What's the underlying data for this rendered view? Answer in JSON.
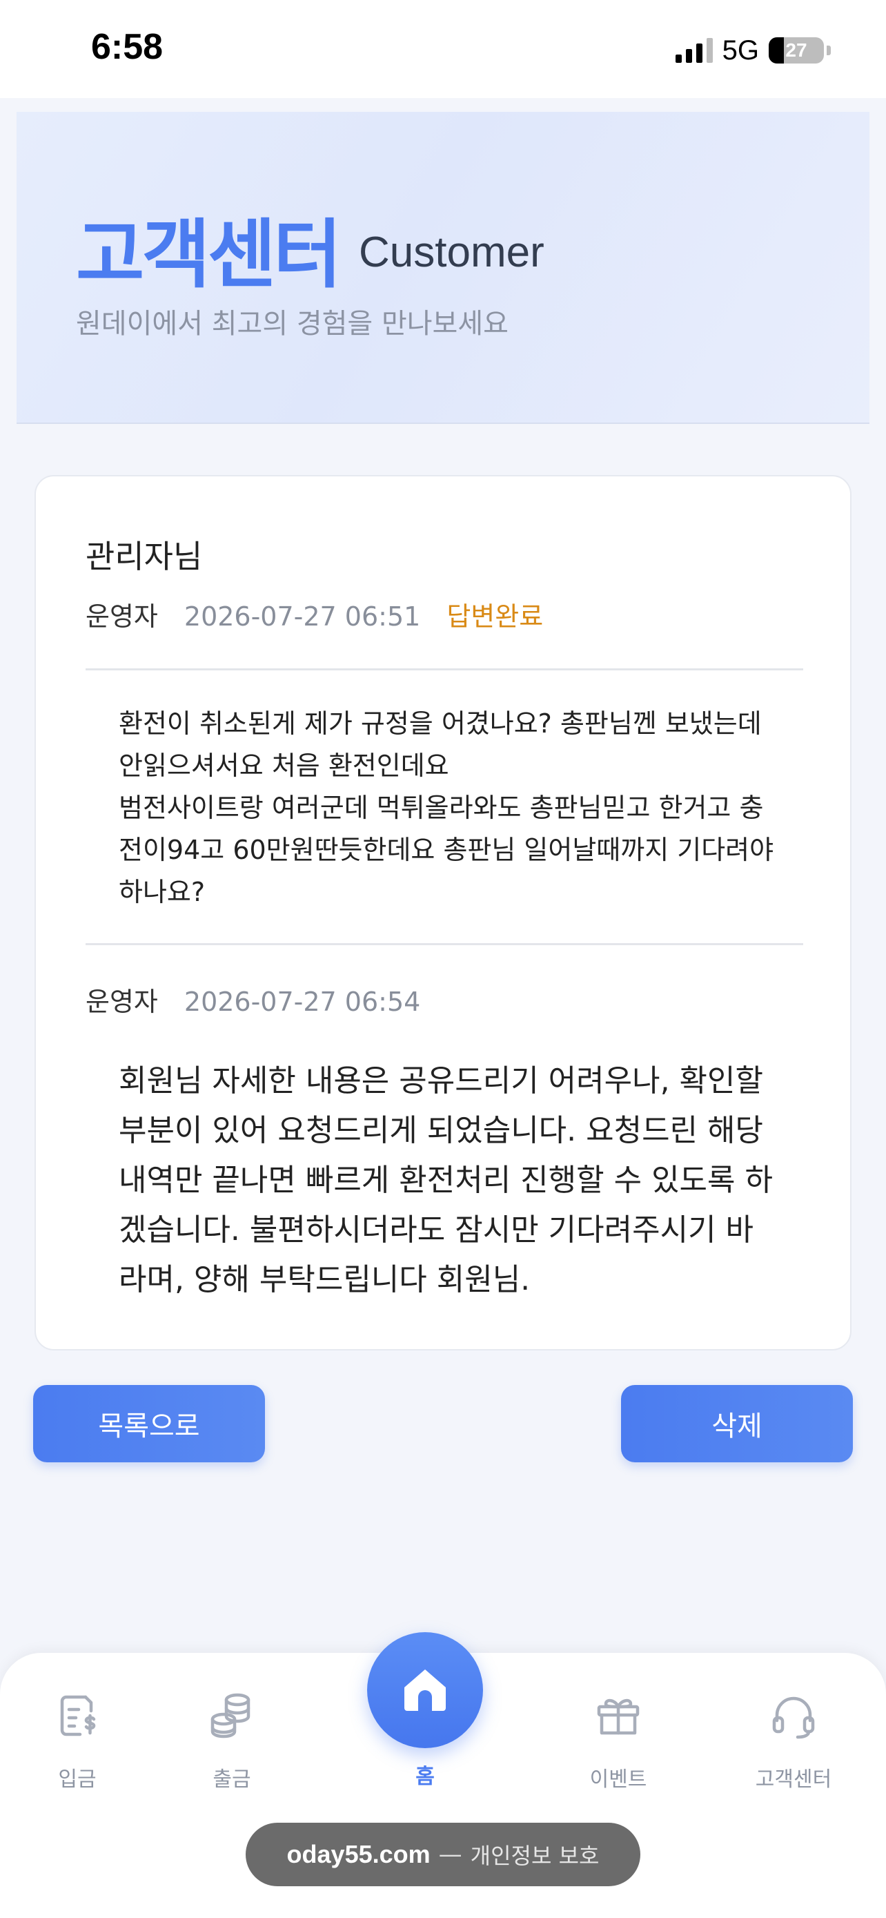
{
  "status_bar": {
    "time": "6:58",
    "network": "5G",
    "battery": "27"
  },
  "hero": {
    "title": "고객센터",
    "subtitle_en": "Customer",
    "description": "원데이에서 최고의 경험을 만나보세요",
    "accent_color": "#4b7cf0"
  },
  "inquiry": {
    "title": "관리자님",
    "author": "운영자",
    "date": "2026-07-27 06:51",
    "status": "답변완료",
    "status_color": "#d98a16",
    "body": "환전이 취소된게 제가 규정을 어겼나요? 총판님껜 보냈는데 안읽으셔서요 처음 환전인데요\n범전사이트랑 여러군데 먹튀올라와도 총판님믿고 한거고 충전이94고 60만원딴듯한데요 총판님 일어날때까지 기다려야하나요?"
  },
  "reply": {
    "author": "운영자",
    "date": "2026-07-27 06:54",
    "body": "회원님 자세한 내용은 공유드리기 어려우나, 확인할 부분이 있어 요청드리게 되었습니다. 요청드린 해당 내역만 끝나면 빠르게 환전처리 진행할 수 있도록 하겠습니다. 불편하시더라도 잠시만 기다려주시기 바라며, 양해 부탁드립니다 회원님."
  },
  "buttons": {
    "list": "목록으로",
    "delete": "삭제"
  },
  "nav": {
    "deposit": "입금",
    "withdraw": "출금",
    "home": "홈",
    "event": "이벤트",
    "support": "고객센터",
    "icons": [
      "dollar-document-icon",
      "coins-icon",
      "home-icon",
      "gift-icon",
      "headset-icon"
    ]
  },
  "browser": {
    "domain": "oday55.com",
    "separator": "—",
    "note": "개인정보 보호"
  }
}
